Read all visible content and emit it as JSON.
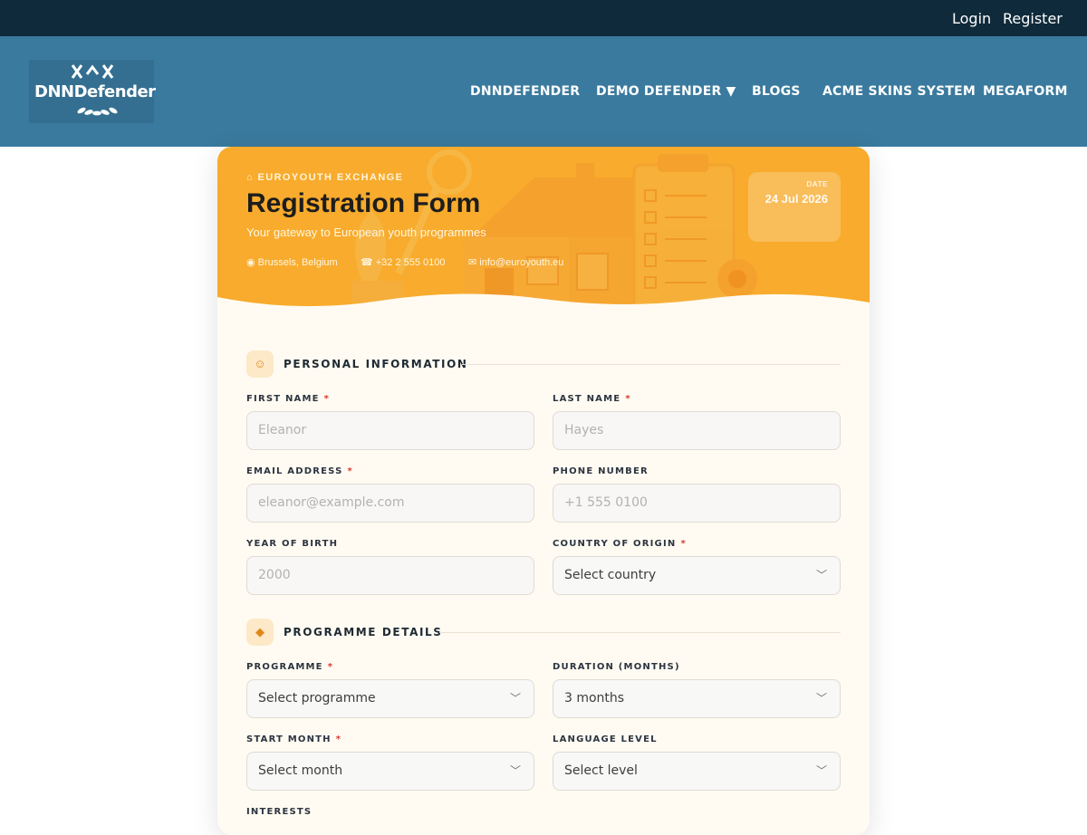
{
  "topbar": {
    "login": "Login",
    "register": "Register"
  },
  "nav": {
    "logo_text": "DNNDefender",
    "items": [
      "DNNDEFENDER",
      "DEMO DEFENDER ▼",
      "BLOGS",
      "ACME SKINS SYSTEM",
      "MEGAFORM"
    ]
  },
  "hero": {
    "eyebrow": "⌂ EUROYOUTH EXCHANGE",
    "title": "Registration Form",
    "subtitle": "Your gateway to European youth programmes",
    "location": "◉ Brussels, Belgium",
    "phone": "☎ +32 2 555 0100",
    "email": "✉ info@euroyouth.eu",
    "date_label": "DATE",
    "date_value": "24 Jul 2026"
  },
  "personal": {
    "icon": "☺",
    "title": "PERSONAL INFORMATION",
    "first_name": {
      "label": "FIRST NAME",
      "required": "*",
      "placeholder": "Eleanor"
    },
    "last_name": {
      "label": "LAST NAME",
      "required": "*",
      "placeholder": "Hayes"
    },
    "email": {
      "label": "EMAIL ADDRESS",
      "required": "*",
      "placeholder": "eleanor@example.com"
    },
    "phone": {
      "label": "PHONE NUMBER",
      "placeholder": "+1 555 0100"
    },
    "birth_year": {
      "label": "YEAR OF BIRTH",
      "placeholder": "2000"
    },
    "country": {
      "label": "COUNTRY OF ORIGIN",
      "required": "*",
      "value": "Select country"
    }
  },
  "programme": {
    "icon": "◆",
    "title": "PROGRAMME DETAILS",
    "programme": {
      "label": "PROGRAMME",
      "required": "*",
      "value": "Select programme"
    },
    "duration": {
      "label": "DURATION (MONTHS)",
      "value": "3 months"
    },
    "start_month": {
      "label": "START MONTH",
      "required": "*",
      "value": "Select month"
    },
    "language_level": {
      "label": "LANGUAGE LEVEL",
      "value": "Select level"
    },
    "interests_label": "INTERESTS"
  },
  "colors": {
    "topbar": "#0f2a3a",
    "navbar": "#3a7a9e",
    "hero": "#f8ab2c",
    "required": "#d43b2f",
    "accent": "#e3861a"
  },
  "icons": {
    "chevron": "chevron-down-icon",
    "section_personal": "smiley-icon",
    "section_programme": "diamond-icon"
  }
}
